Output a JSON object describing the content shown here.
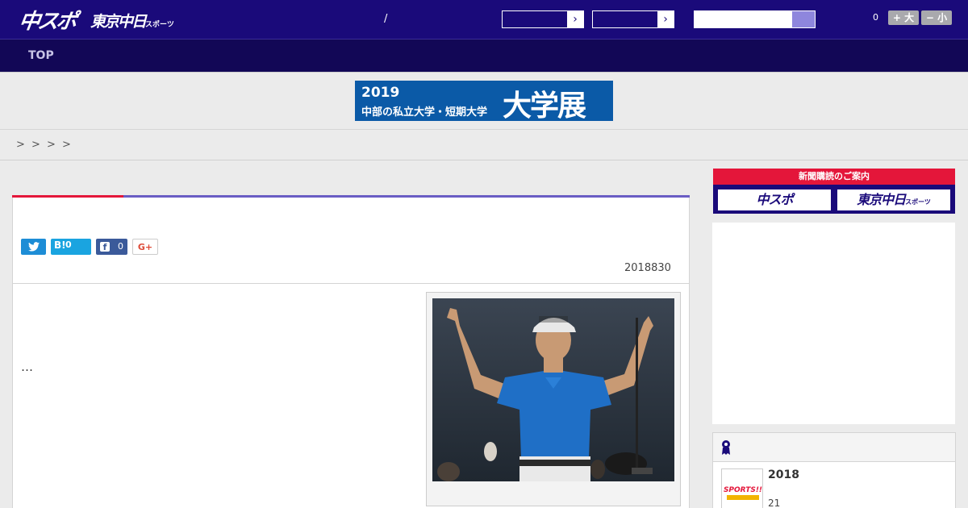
{
  "header": {
    "logo_chuspo": "中スポ",
    "logo_tokyo": "東京中日",
    "logo_tokyo_small": "スポーツ",
    "slash": "/",
    "select1_arrow": "›",
    "select2_arrow": "›",
    "search_placeholder": "",
    "font_count": "0",
    "font_larger": "+ 大",
    "font_smaller": "− 小"
  },
  "nav": {
    "top_label": "TOP"
  },
  "banner": {
    "year": "2019",
    "subtitle": "中部の私立大学・短期大学",
    "title": "大学展"
  },
  "breadcrumb": {
    "separators": [
      ">",
      ">",
      ">",
      ">"
    ]
  },
  "article": {
    "share": {
      "twitter_icon": "🐦",
      "hatena_label": "B!",
      "hatena_count": "0",
      "facebook_icon": "f",
      "facebook_count": "0",
      "gplus_label": "G+"
    },
    "date": "2018830",
    "excerpt": "…"
  },
  "sidebar": {
    "subscribe_header": "新聞購読のご案内",
    "subscribe_chuspo": "中スポ",
    "subscribe_tokyo": "東京中日",
    "subscribe_tokyo_small": "スポーツ",
    "ranking": {
      "item_title": "2018",
      "item_sub": "21",
      "thumb_text": "SPORTS!!"
    }
  },
  "colors": {
    "header_bg": "#1a0a7a",
    "nav_bg": "#120756",
    "accent_red": "#e4163a",
    "accent_purple": "#6a5dc4",
    "banner_blue": "#0b5aa7"
  }
}
